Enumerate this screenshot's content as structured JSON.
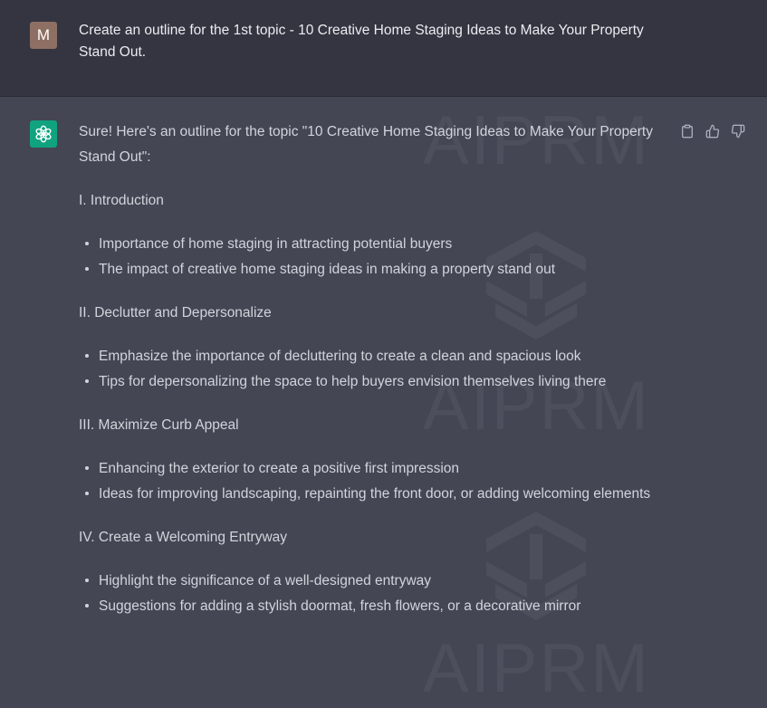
{
  "user": {
    "avatar_letter": "M",
    "message": "Create an outline for the 1st topic - 10 Creative Home Staging Ideas to Make Your Property Stand Out."
  },
  "assistant": {
    "intro": "Sure! Here's an outline for the topic \"10 Creative Home Staging Ideas to Make Your Property Stand Out\":",
    "sections": [
      {
        "heading": "I. Introduction",
        "bullets": [
          "Importance of home staging in attracting potential buyers",
          "The impact of creative home staging ideas in making a property stand out"
        ]
      },
      {
        "heading": "II. Declutter and Depersonalize",
        "bullets": [
          "Emphasize the importance of decluttering to create a clean and spacious look",
          "Tips for depersonalizing the space to help buyers envision themselves living there"
        ]
      },
      {
        "heading": "III. Maximize Curb Appeal",
        "bullets": [
          "Enhancing the exterior to create a positive first impression",
          "Ideas for improving landscaping, repainting the front door, or adding welcoming elements"
        ]
      },
      {
        "heading": "IV. Create a Welcoming Entryway",
        "bullets": [
          "Highlight the significance of a well-designed entryway",
          "Suggestions for adding a stylish doormat, fresh flowers, or a decorative mirror"
        ]
      }
    ]
  },
  "actions": {
    "copy_icon": "clipboard-icon",
    "like_icon": "thumbs-up-icon",
    "dislike_icon": "thumbs-down-icon"
  },
  "watermark": {
    "text": "AIPRM"
  },
  "colors": {
    "user_bg": "#343541",
    "assistant_bg": "#444654",
    "bot_avatar": "#10a37f",
    "user_avatar": "#8e6f63"
  }
}
